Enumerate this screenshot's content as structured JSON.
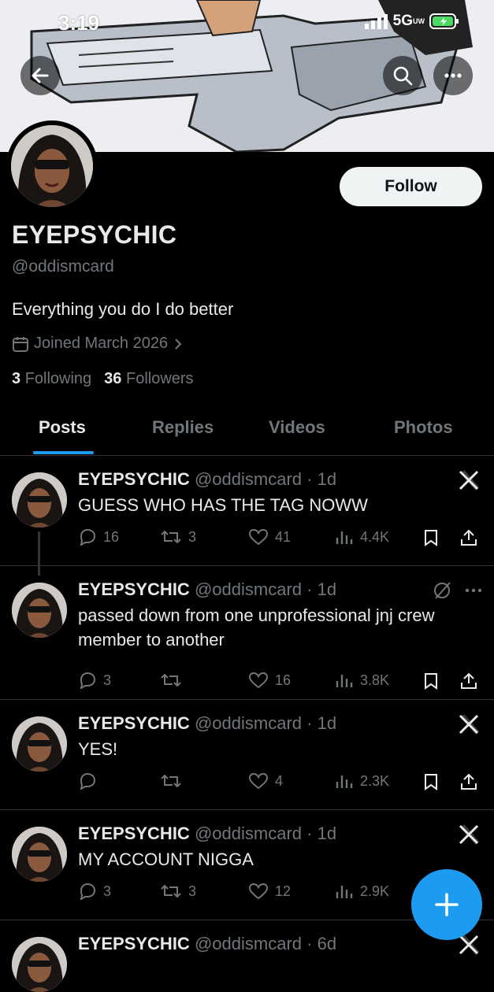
{
  "status_bar": {
    "time": "3:19",
    "network": "5G",
    "network_sub": "UW"
  },
  "profile": {
    "display_name": "EYEPSYCHIC",
    "handle": "@oddismcard",
    "bio": "Everything you do I do better",
    "joined": "Joined March 2026",
    "following_count": "3",
    "following_label": "Following",
    "followers_count": "36",
    "followers_label": "Followers",
    "follow_label": "Follow"
  },
  "tabs": [
    "Posts",
    "Replies",
    "Videos",
    "Photos"
  ],
  "active_tab": "Posts",
  "posts": [
    {
      "name": "EYEPSYCHIC",
      "handle": "@oddismcard",
      "time": "1d",
      "text": "GUESS WHO HAS THE TAG NOWW",
      "replies": "16",
      "reposts": "3",
      "likes": "41",
      "views": "4.4K",
      "corner_icon": "x-logo-icon"
    },
    {
      "name": "EYEPSYCHIC",
      "handle": "@oddismcard",
      "time": "1d",
      "text": "passed down from one unprofessional jnj crew member to another",
      "replies": "3",
      "reposts": "",
      "likes": "16",
      "views": "3.8K",
      "corner_icon": "grok-icon"
    },
    {
      "name": "EYEPSYCHIC",
      "handle": "@oddismcard",
      "time": "1d",
      "text": "YES!",
      "replies": "",
      "reposts": "",
      "likes": "4",
      "views": "2.3K",
      "corner_icon": "x-logo-icon"
    },
    {
      "name": "EYEPSYCHIC",
      "handle": "@oddismcard",
      "time": "1d",
      "text": "MY ACCOUNT NIGGA",
      "replies": "3",
      "reposts": "3",
      "likes": "12",
      "views": "2.9K",
      "corner_icon": "x-logo-icon"
    },
    {
      "name": "EYEPSYCHIC",
      "handle": "@oddismcard",
      "time": "6d",
      "text": "",
      "corner_icon": "x-logo-icon"
    }
  ],
  "colors": {
    "accent": "#1d9bf0",
    "background": "#000000",
    "muted": "#71767b",
    "text": "#e7e9ea",
    "divider": "#2f3336"
  }
}
